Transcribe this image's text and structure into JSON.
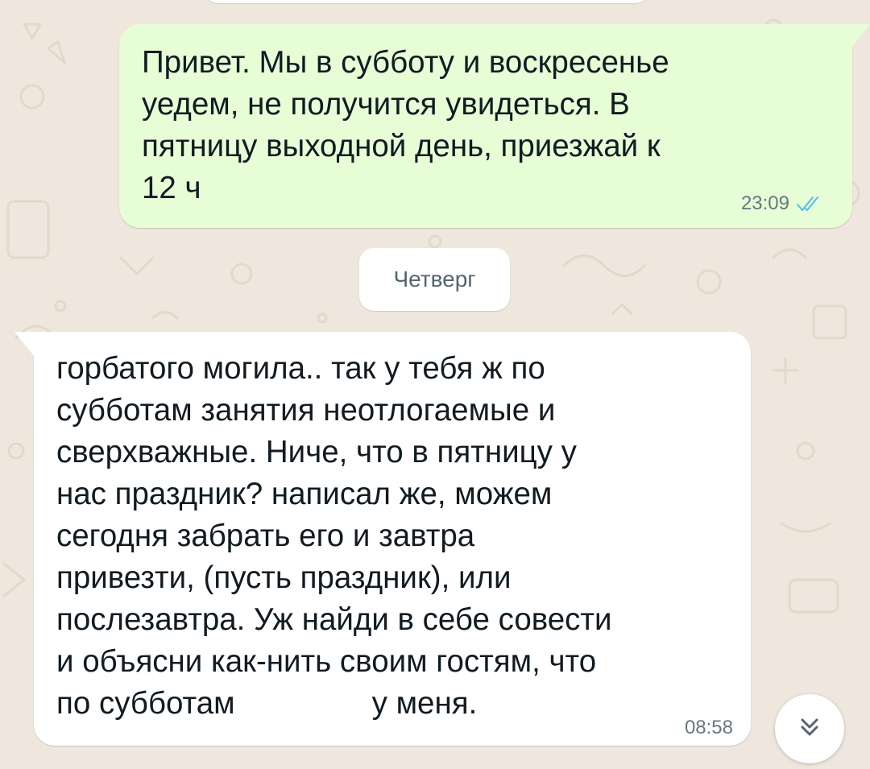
{
  "chat": {
    "outgoing": {
      "text": "Привет. Мы в субботу и воскресенье\nуедем, не получится увидеться. В\nпятницу выходной день, приезжай к\n12 ч",
      "time": "23:09",
      "status_icon": "double-check-read-icon"
    },
    "date_separator": "Четверг",
    "incoming": {
      "text_main": "горбатого могила.. так у тебя ж по\nсубботам занятия неотлогаемые и\nсверхважные. Ниче, что в пятницу у\nнас праздник? написал же, можем\nсегодня забрать его и завтра\nпривезти, (пусть праздник), или\nпослезавтра. Уж найди в себе совести\nи объясни как-нить своим гостям, что\nпо субботам",
      "text_tail": "у меня.",
      "time": "08:58"
    },
    "scroll_button_icon": "chevron-double-down-icon"
  },
  "colors": {
    "wallpaper": "#efe7de",
    "outgoing_bubble": "#e7fdd6",
    "incoming_bubble": "#ffffff",
    "read_ticks": "#53bdeb",
    "meta_text": "#667781",
    "message_text": "#111b21"
  }
}
